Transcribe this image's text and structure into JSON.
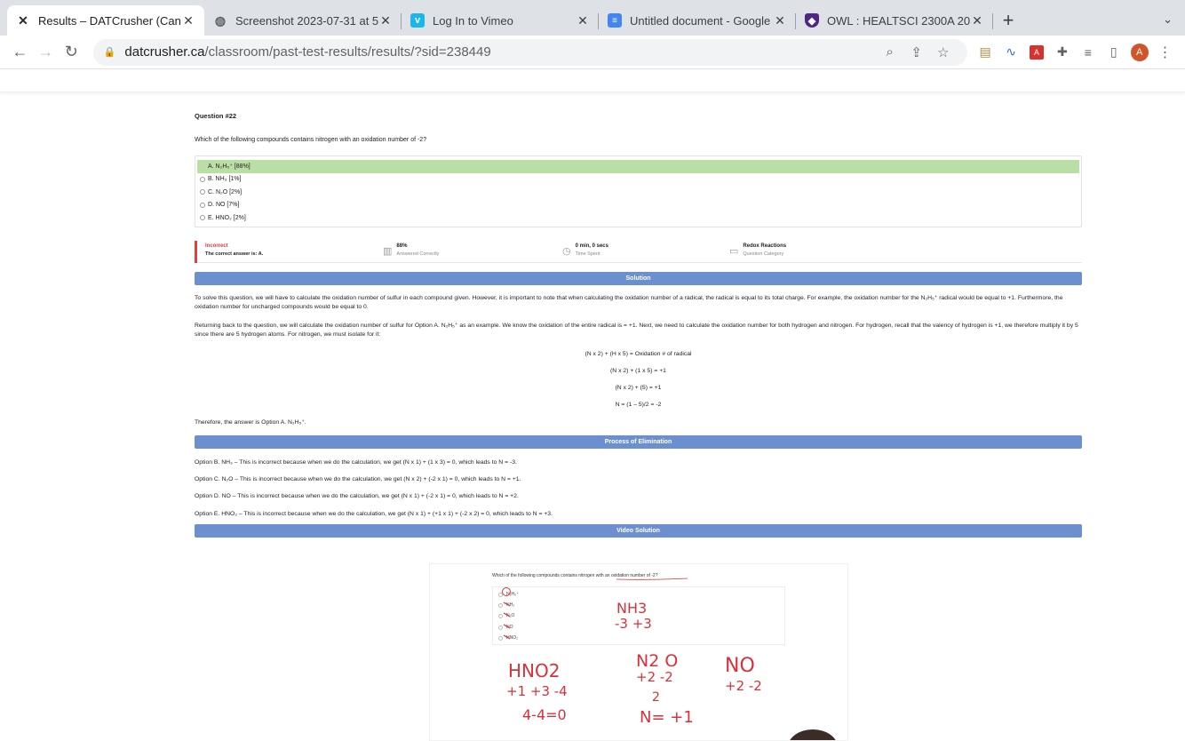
{
  "browser": {
    "tabs": [
      {
        "title": "Results – DATCrusher (Canadia",
        "active": true,
        "favicon": "datcrusher-icon"
      },
      {
        "title": "Screenshot 2023-07-31 at 5.0",
        "active": false,
        "favicon": "globe-icon"
      },
      {
        "title": "Log In to Vimeo",
        "active": false,
        "favicon": "vimeo-icon"
      },
      {
        "title": "Untitled document - Google Do",
        "active": false,
        "favicon": "google-docs-icon"
      },
      {
        "title": "OWL : HEALTSCI 2300A 200 S",
        "active": false,
        "favicon": "owl-icon"
      }
    ],
    "url_host": "datcrusher.ca",
    "url_path": "/classroom/past-test-results/results/?sid=238449",
    "avatar_letter": "A"
  },
  "question": {
    "number": "Question #22",
    "text": "Which of the following compounds contains nitrogen with an oxidation number of -2?",
    "options": [
      {
        "label": "A. N₂H₅⁺ [88%]",
        "correct": true
      },
      {
        "label": "B. NH₃ [1%]",
        "correct": false
      },
      {
        "label": "C. N₂O [2%]",
        "correct": false
      },
      {
        "label": "D. NO [7%]",
        "correct": false
      },
      {
        "label": "E. HNO₂ [2%]",
        "correct": false
      }
    ]
  },
  "stats": {
    "result_title": "Incorrect",
    "result_sub": "The correct answer is: A.",
    "percent": "88%",
    "percent_label": "Answered Correctly",
    "time": "0 min, 0 secs",
    "time_label": "Time Spent",
    "category": "Redox Reactions",
    "category_label": "Question Category"
  },
  "solution": {
    "banner": "Solution",
    "p1": "To solve this question, we will have to calculate the oxidation number of sulfur in each compound given. However, it is important to note that when calculating the oxidation number of a radical, the radical is equal to its total charge. For example, the oxidation number for the N₂H₅⁺ radical would be equal to +1. Furthermore, the oxidation number for uncharged compounds would be equal to 0.",
    "p2": "Returning back to the question, we will calculate the oxidation number of sulfur for Option A. N₂H₅⁺ as an example. We know the oxidation of the entire radical is = +1. Next, we need to calculate the oxidation number for both hydrogen and nitrogen. For hydrogen, recall that the valency of hydrogen is +1, we therefore multiply it by 5 since there are 5 hydrogen atoms. For nitrogen, we must isolate for it:",
    "eq1": "(N x 2) + (H x 5) = Oxidation # of radical",
    "eq2": "(N x 2) + (1 x 5) = +1",
    "eq3": "(N x 2) + (5) = +1",
    "eq4": "N = (1 – 5)/2 = -2",
    "conclusion": "Therefore, the answer is Option A. N₂H₅⁺."
  },
  "elimination": {
    "banner": "Process of Elimination",
    "items": [
      "Option B. NH₃ – This is incorrect because when we do the calculation, we get (N x 1) + (1 x 3) = 0, which leads to N = -3.",
      "Option C. N₂O – This is incorrect because when we do the calculation, we get (N x 2) + (-2 x 1) = 0, which leads to N = +1.",
      "Option D. NO – This is incorrect because when we do the calculation, we get (N x 1) + (-2 x 1) = 0, which leads to N = +2.",
      "Option E. HNO₂ – This is incorrect because when we do the calculation, we get (N x 1) + (+1 x 1) + (-2 x 2) = 0, which leads to N = +3."
    ]
  },
  "video": {
    "banner": "Video Solution",
    "question": "Which of the following compounds contains nitrogen with an oxidation number of -2?",
    "options": [
      "N₂H₅⁺",
      "NH₃",
      "N₂O",
      "NO",
      "HNO₂"
    ],
    "hand_nh3": "NH3",
    "hand_nh3_vals": "-3 +3",
    "hand_hno2": "HNO2",
    "hand_hno2_vals": "+1 +3 -4",
    "hand_hno2_sum": "4-4=0",
    "hand_n2o": "N2 O",
    "hand_n2o_vals": "+2 -2",
    "hand_n2o_div": "2",
    "hand_n2o_res": "N= +1",
    "hand_no": "NO",
    "hand_no_vals": "+2 -2"
  }
}
